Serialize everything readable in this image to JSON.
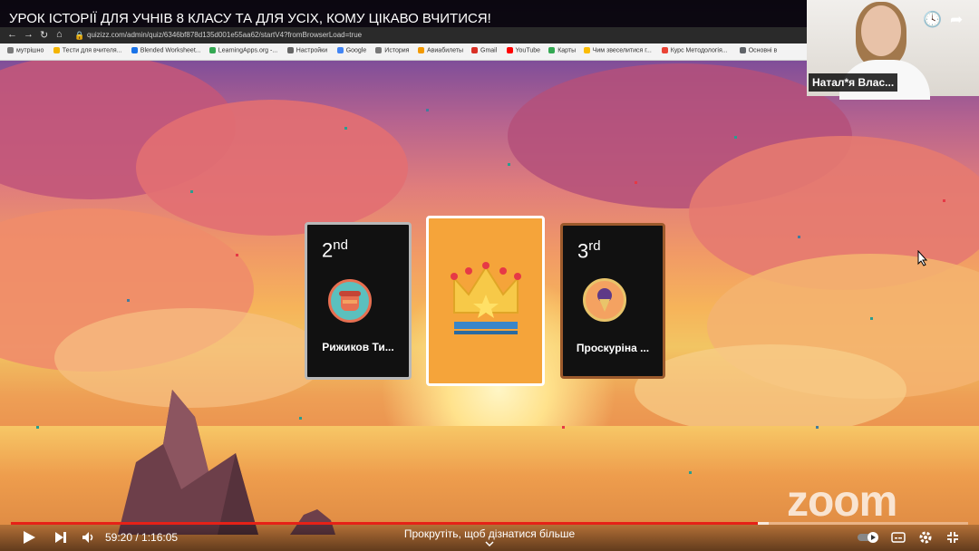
{
  "browser": {
    "page_title": "УРОК ІСТОРІЇ ДЛЯ УЧНІВ 8 КЛАСУ ТА ДЛЯ УСІХ, КОМУ ЦІКАВО ВЧИТИСЯ!",
    "url": "quizizz.com/admin/quiz/6346bf878d135d001e55aa62/startV4?fromBrowserLoad=true",
    "bookmarks": [
      "мутрішно",
      "Тести для вчителя...",
      "Blended Worksheet...",
      "LearningApps.org -...",
      "Настройки",
      "Google",
      "История",
      "Авиабилеты",
      "Gmail",
      "YouTube",
      "Карты",
      "Чим звеселитися г...",
      "Курс Методологія...",
      "Основні в"
    ]
  },
  "video_participant": {
    "name": "Натал*я Влас..."
  },
  "leaderboard": {
    "second": {
      "rank_number": "2",
      "rank_suffix": "nd",
      "player": "Рижиков Ти..."
    },
    "third": {
      "rank_number": "3",
      "rank_suffix": "rd",
      "player": "Проскуріна ..."
    }
  },
  "player": {
    "time": "59:20 / 1:16:05",
    "scroll_hint": "Прокрутіть, щоб дізнатися більше",
    "progress": 0.78,
    "watermark": "zoom"
  },
  "colors": {
    "progress": "#e62117",
    "winner_card": "#f5a43a"
  }
}
